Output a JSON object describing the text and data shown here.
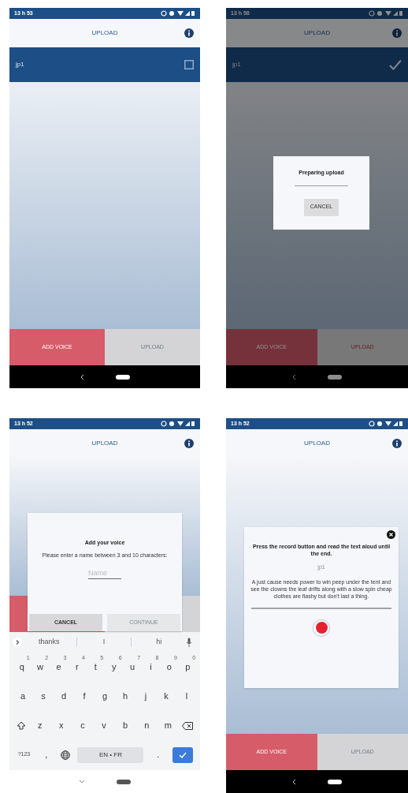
{
  "screens": [
    {
      "status_bar": {
        "time": "13 h 53"
      },
      "app_bar": {
        "title": "UPLOAD"
      },
      "rows": [
        {
          "label": "jp1",
          "checked": false
        }
      ],
      "bottom_buttons": [
        {
          "label": "ADD VOICE",
          "disabled": false
        },
        {
          "label": "UPLOAD",
          "disabled": true
        }
      ]
    },
    {
      "status_bar": {
        "time": "13 h 58"
      },
      "app_bar": {
        "title": "UPLOAD"
      },
      "rows": [
        {
          "label": "jp1",
          "checked": true
        }
      ],
      "bottom_buttons": [
        {
          "label": "ADD VOICE",
          "disabled": false
        },
        {
          "label": "UPLOAD",
          "disabled": false
        }
      ],
      "dialog": {
        "kind": "progress",
        "dim_background": true,
        "title": "Preparing upload",
        "buttons": [
          {
            "label": "CANCEL",
            "disabled": false
          }
        ]
      }
    },
    {
      "status_bar": {
        "time": "13 h 52"
      },
      "app_bar": {
        "title": "UPLOAD"
      },
      "bottom_buttons": [
        {
          "kind": "primary"
        },
        {
          "kind": "secondary"
        }
      ],
      "dialog": {
        "kind": "name_input",
        "title": "Add your voice",
        "message": "Please enter a name between 3 and 10 characters:",
        "placeholder": "Name",
        "buttons": [
          {
            "label": "CANCEL",
            "disabled": false
          },
          {
            "label": "CONTINUE",
            "disabled": true
          }
        ]
      },
      "keyboard": {
        "suggestions": [
          "thanks",
          "I",
          "hi"
        ],
        "key_rows": [
          {
            "keys": [
              {
                "key": "q",
                "hint": "1"
              },
              {
                "key": "w",
                "hint": "2"
              },
              {
                "key": "e",
                "hint": "3"
              },
              {
                "key": "r",
                "hint": "4"
              },
              {
                "key": "t",
                "hint": "5"
              },
              {
                "key": "y",
                "hint": "6"
              },
              {
                "key": "u",
                "hint": "7"
              },
              {
                "key": "i",
                "hint": "8"
              },
              {
                "key": "o",
                "hint": "9"
              },
              {
                "key": "p",
                "hint": "0"
              }
            ]
          },
          {
            "keys": [
              {
                "key": "a"
              },
              {
                "key": "s"
              },
              {
                "key": "d"
              },
              {
                "key": "f"
              },
              {
                "key": "g"
              },
              {
                "key": "h"
              },
              {
                "key": "j"
              },
              {
                "key": "k"
              },
              {
                "key": "l"
              }
            ]
          },
          {
            "keys": [
              {
                "kind": "shift"
              },
              {
                "key": "z"
              },
              {
                "key": "x"
              },
              {
                "key": "c"
              },
              {
                "key": "v"
              },
              {
                "key": "b"
              },
              {
                "key": "n"
              },
              {
                "key": "m"
              },
              {
                "kind": "backspace"
              }
            ]
          },
          {
            "keys": [
              {
                "key": "?123"
              },
              {
                "key": ","
              },
              {
                "kind": "globe"
              },
              {
                "kind": "space",
                "key": "EN • FR"
              },
              {
                "key": "."
              },
              {
                "kind": "enter"
              }
            ]
          }
        ]
      }
    },
    {
      "status_bar": {
        "time": "13 h 52"
      },
      "app_bar": {
        "title": "UPLOAD"
      },
      "bottom_buttons": [
        {
          "label": "ADD VOICE",
          "disabled": false
        },
        {
          "label": "UPLOAD",
          "disabled": true
        }
      ],
      "dialog": {
        "kind": "record",
        "title": "Press the record button and read the text aloud until the end.",
        "name": "jp1",
        "passage": "A just cause needs power to win peep under the tent and see the clowns the leaf drifts along with a slow spin cheap clothes are flashy but don't last a thing."
      }
    }
  ]
}
